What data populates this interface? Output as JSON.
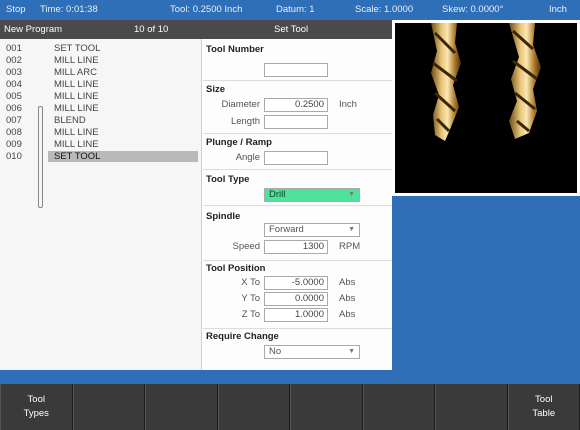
{
  "status_bar": {
    "mode": "Stop",
    "time": "Time: 0:01:38",
    "tool": "Tool: 0.2500 Inch",
    "datum": "Datum: 1",
    "scale": "Scale: 1.0000",
    "skew": "Skew: 0.0000°",
    "units": "Inch"
  },
  "title_bar": {
    "program_name": "New Program",
    "position": "10 of 10",
    "step_title": "Set Tool"
  },
  "program_steps": [
    {
      "num": "001",
      "name": "SET TOOL"
    },
    {
      "num": "002",
      "name": "MILL LINE"
    },
    {
      "num": "003",
      "name": "MILL ARC"
    },
    {
      "num": "004",
      "name": "MILL LINE"
    },
    {
      "num": "005",
      "name": "MILL LINE"
    },
    {
      "num": "006",
      "name": "MILL LINE"
    },
    {
      "num": "007",
      "name": "BLEND"
    },
    {
      "num": "008",
      "name": "MILL LINE"
    },
    {
      "num": "009",
      "name": "MILL LINE"
    },
    {
      "num": "010",
      "name": "SET TOOL"
    }
  ],
  "form": {
    "tool_number": {
      "title": "Tool Number",
      "value": ""
    },
    "size": {
      "title": "Size",
      "diameter_label": "Diameter",
      "diameter_value": "0.2500",
      "diameter_unit": "Inch",
      "length_label": "Length",
      "length_value": ""
    },
    "plunge": {
      "title": "Plunge / Ramp",
      "angle_label": "Angle",
      "angle_value": ""
    },
    "tool_type": {
      "title": "Tool Type",
      "value": "Drill"
    },
    "spindle": {
      "title": "Spindle",
      "direction": "Forward",
      "speed_label": "Speed",
      "speed_value": "1300",
      "speed_unit": "RPM"
    },
    "tool_position": {
      "title": "Tool Position",
      "x_label": "X To",
      "x_value": "-5.0000",
      "x_unit": "Abs",
      "y_label": "Y To",
      "y_value": "0.0000",
      "y_unit": "Abs",
      "z_label": "Z To",
      "z_value": "1.0000",
      "z_unit": "Abs"
    },
    "require_change": {
      "title": "Require Change",
      "value": "No"
    }
  },
  "softkeys": {
    "k1_line1": "Tool",
    "k1_line2": "Types",
    "k8_line1": "Tool",
    "k8_line2": "Table"
  },
  "colors": {
    "status_blue": "#2e6fb7",
    "highlight_green": "#4fe29a",
    "softkey_gray": "#3a3a3a"
  },
  "icons": {
    "preview": "drill-bit-icon",
    "dropdown": "chevron-down-icon"
  }
}
